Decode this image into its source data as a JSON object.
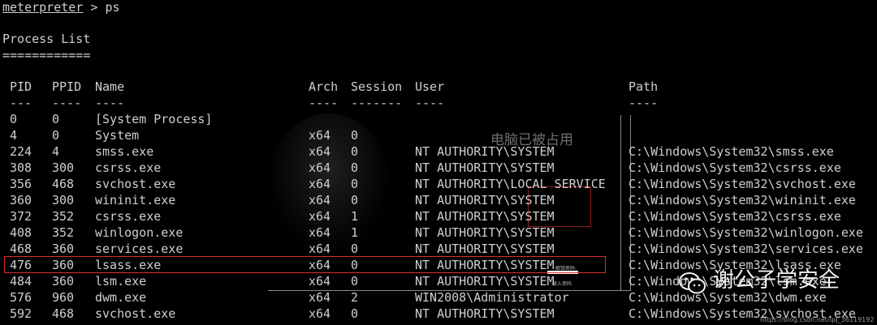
{
  "prompt": {
    "name": "meterpreter",
    "separator": " > ",
    "command": "ps"
  },
  "section": {
    "title": "Process List",
    "underline": "============"
  },
  "table": {
    "headers": {
      "pid": "PID",
      "ppid": "PPID",
      "name": "Name",
      "arch": "Arch",
      "session": "Session",
      "user": "User",
      "path": "Path"
    },
    "dividers": {
      "pid": "---",
      "ppid": "----",
      "name": "----",
      "arch": "----",
      "session": "-------",
      "user": "----",
      "path": "----"
    },
    "rows": [
      {
        "pid": "0",
        "ppid": "0",
        "name": "[System Process]",
        "arch": "",
        "session": "",
        "user": "",
        "path": ""
      },
      {
        "pid": "4",
        "ppid": "0",
        "name": "System",
        "arch": "x64",
        "session": "0",
        "user": "",
        "path": ""
      },
      {
        "pid": "224",
        "ppid": "4",
        "name": "smss.exe",
        "arch": "x64",
        "session": "0",
        "user": "NT AUTHORITY\\SYSTEM",
        "path": "C:\\Windows\\System32\\smss.exe"
      },
      {
        "pid": "308",
        "ppid": "300",
        "name": "csrss.exe",
        "arch": "x64",
        "session": "0",
        "user": "NT AUTHORITY\\SYSTEM",
        "path": "C:\\Windows\\System32\\csrss.exe"
      },
      {
        "pid": "356",
        "ppid": "468",
        "name": "svchost.exe",
        "arch": "x64",
        "session": "0",
        "user": "NT AUTHORITY\\LOCAL SERVICE",
        "path": "C:\\Windows\\System32\\svchost.exe"
      },
      {
        "pid": "360",
        "ppid": "300",
        "name": "wininit.exe",
        "arch": "x64",
        "session": "0",
        "user": "NT AUTHORITY\\SYSTEM",
        "path": "C:\\Windows\\System32\\wininit.exe"
      },
      {
        "pid": "372",
        "ppid": "352",
        "name": "csrss.exe",
        "arch": "x64",
        "session": "1",
        "user": "NT AUTHORITY\\SYSTEM",
        "path": "C:\\Windows\\System32\\csrss.exe"
      },
      {
        "pid": "408",
        "ppid": "352",
        "name": "winlogon.exe",
        "arch": "x64",
        "session": "1",
        "user": "NT AUTHORITY\\SYSTEM",
        "path": "C:\\Windows\\System32\\winlogon.exe"
      },
      {
        "pid": "468",
        "ppid": "360",
        "name": "services.exe",
        "arch": "x64",
        "session": "0",
        "user": "NT AUTHORITY\\SYSTEM",
        "path": "C:\\Windows\\System32\\services.exe"
      },
      {
        "pid": "476",
        "ppid": "360",
        "name": "lsass.exe",
        "arch": "x64",
        "session": "0",
        "user": "NT AUTHORITY\\SYSTEM",
        "path": "C:\\Windows\\System32\\lsass.exe"
      },
      {
        "pid": "484",
        "ppid": "360",
        "name": "lsm.exe",
        "arch": "x64",
        "session": "0",
        "user": "NT AUTHORITY\\SYSTEM",
        "path": "C:\\Windows\\System32\\lsm.exe"
      },
      {
        "pid": "576",
        "ppid": "960",
        "name": "dwm.exe",
        "arch": "x64",
        "session": "2",
        "user": "WIN2008\\Administrator",
        "path": "C:\\Windows\\System32\\dwm.exe"
      },
      {
        "pid": "592",
        "ppid": "468",
        "name": "svchost.exe",
        "arch": "x64",
        "session": "0",
        "user": "NT AUTHORITY\\SYSTEM",
        "path": "C:\\Windows\\System32\\svchost.exe"
      }
    ],
    "highlighted_pid": "476"
  },
  "overlay": {
    "occupied_text": "电脑已被占用",
    "small_label_1": "解锁密码:",
    "small_label_2": "输入密码"
  },
  "watermark": {
    "text": "谢公子学安全",
    "url": "https://blog.csdn.net/qq_36119192"
  },
  "colors": {
    "background": "#000000",
    "text": "#cfcfcf",
    "highlight": "#d9302c"
  }
}
